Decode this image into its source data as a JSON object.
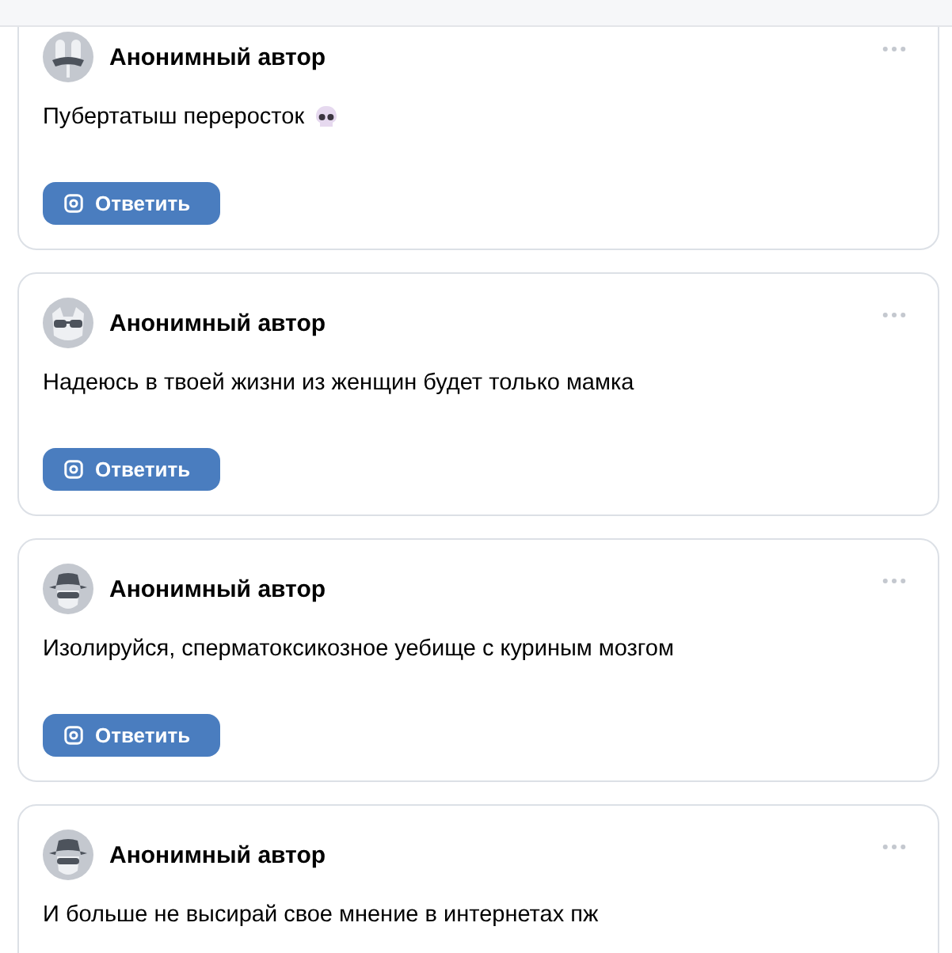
{
  "posts": [
    {
      "avatar": {
        "kind": "mask"
      },
      "author": "Анонимный автор",
      "text": "Пубертатыш переросток",
      "skull_emoji": true,
      "reply_button": "Ответить"
    },
    {
      "avatar": {
        "kind": "glasses"
      },
      "author": "Анонимный автор",
      "text": "Надеюсь в твоей жизни из женщин будет только мамка",
      "reply_button": "Ответить"
    },
    {
      "avatar": {
        "kind": "spy"
      },
      "author": "Анонимный автор",
      "text": "Изолируйся, сперматоксикозное уебище с куриным мозгом",
      "reply_button": "Ответить"
    },
    {
      "avatar": {
        "kind": "spy"
      },
      "author": "Анонимный автор",
      "text": "И больше не высирай свое мнение в интернетах пж"
    }
  ]
}
